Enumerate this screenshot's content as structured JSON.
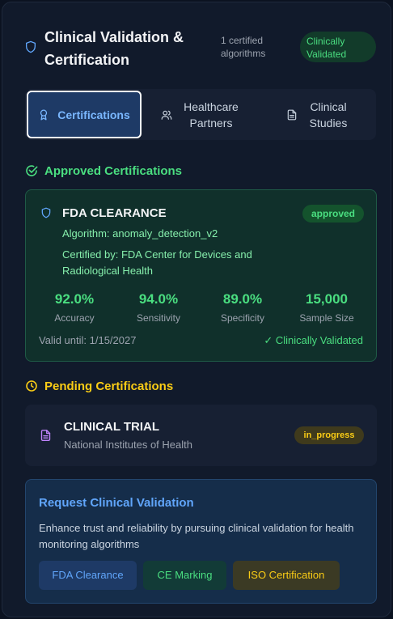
{
  "header": {
    "title": "Clinical Validation & Certification",
    "count_label": "1 certified algorithms",
    "status_badge": "Clinically Validated"
  },
  "tabs": [
    {
      "label": "Certifications",
      "icon": "award-icon",
      "active": true
    },
    {
      "label": "Healthcare Partners",
      "icon": "users-icon",
      "active": false
    },
    {
      "label": "Clinical Studies",
      "icon": "document-icon",
      "active": false
    }
  ],
  "approved": {
    "heading": "Approved Certifications",
    "card": {
      "title": "FDA CLEARANCE",
      "status": "approved",
      "algorithm": "Algorithm: anomaly_detection_v2",
      "certified_by": "Certified by: FDA Center for Devices and Radiological Health",
      "metrics": [
        {
          "value": "92.0%",
          "label": "Accuracy"
        },
        {
          "value": "94.0%",
          "label": "Sensitivity"
        },
        {
          "value": "89.0%",
          "label": "Specificity"
        },
        {
          "value": "15,000",
          "label": "Sample Size"
        }
      ],
      "valid_until": "Valid until: 1/15/2027",
      "clinical": "✓ Clinically Validated"
    }
  },
  "pending": {
    "heading": "Pending Certifications",
    "card": {
      "title": "CLINICAL TRIAL",
      "organization": "National Institutes of Health",
      "status": "in_progress"
    }
  },
  "request": {
    "title": "Request Clinical Validation",
    "description": "Enhance trust and reliability by pursuing clinical validation for health monitoring algorithms",
    "buttons": [
      "FDA Clearance",
      "CE Marking",
      "ISO Certification"
    ]
  },
  "colors": {
    "accent_green": "#4ade80",
    "accent_blue": "#60a5fa",
    "accent_yellow": "#facc15",
    "panel_bg": "#111a2b"
  }
}
